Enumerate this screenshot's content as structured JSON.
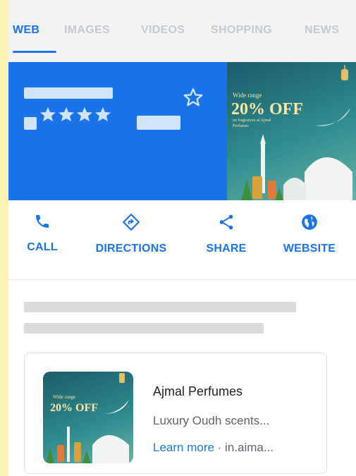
{
  "tabs": [
    {
      "label": "WEB",
      "active": true
    },
    {
      "label": "IMAGES",
      "active": false
    },
    {
      "label": "VIDEOS",
      "active": false
    },
    {
      "label": "SHOPPING",
      "active": false
    },
    {
      "label": "NEWS",
      "active": false
    }
  ],
  "hero": {
    "rating_stars": 4,
    "banner": {
      "line1": "Wide range",
      "headline": "20% OFF",
      "line2": "on fragrances at Ajmal",
      "line3": "Perfumes"
    }
  },
  "actions": [
    {
      "label": "CALL",
      "icon": "phone-icon"
    },
    {
      "label": "DIRECTIONS",
      "icon": "directions-icon"
    },
    {
      "label": "SHARE",
      "icon": "share-icon"
    },
    {
      "label": "WEBSITE",
      "icon": "globe-icon"
    }
  ],
  "ad": {
    "title": "Ajmal Perfumes",
    "description": "Luxury Oudh scents...",
    "link_label": "Learn more",
    "separator": " · ",
    "domain": "in.aima..."
  },
  "colors": {
    "accent": "#1a73e8",
    "page_background": "#fdf3b4",
    "placeholder": "#d2e3fc",
    "skeleton": "#d9dbdd"
  }
}
